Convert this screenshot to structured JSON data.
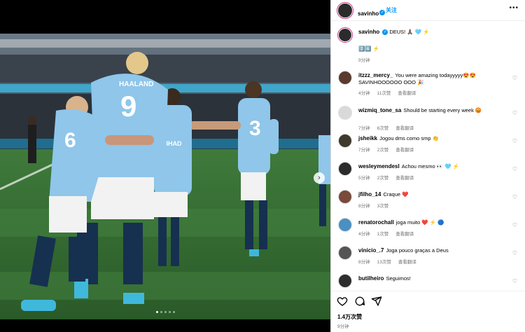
{
  "post": {
    "author": "savinho",
    "follow_label": "关注",
    "more_menu": "•••"
  },
  "caption": {
    "username": "savinho",
    "text": "DEUS! 🙏🏾 🩵 ⚡",
    "extra_line": "2️⃣6️⃣ ⚡",
    "time": "9分钟"
  },
  "comments": [
    {
      "username": "itzzz_mercy_",
      "text": "You were amazing todayyyyy😍😍 SAVINHOOOOOO OOO 🎉",
      "time": "4分钟",
      "likes": "11次赞",
      "translate": "查看翻译",
      "avatar_color": "#5a3b2e"
    },
    {
      "username": "wizmiq_tone_sa",
      "text": "Should be starting every week 😡",
      "time": "7分钟",
      "likes": "6次赞",
      "translate": "查看翻译",
      "avatar_color": "#d9d9d9"
    },
    {
      "username": "jsheikk",
      "text": "Jogou dms como smp 👏",
      "time": "7分钟",
      "likes": "2次赞",
      "translate": "查看翻译",
      "avatar_color": "#3d3a2c"
    },
    {
      "username": "wesleymendesl",
      "text": "Achou mesmo 👀 🩵 ⚡",
      "time": "5分钟",
      "likes": "2次赞",
      "translate": "查看翻译",
      "avatar_color": "#2c2c2c"
    },
    {
      "username": "jfilho_14",
      "text": "Craque ❤️",
      "time": "8分钟",
      "likes": "3次赞",
      "translate": "",
      "avatar_color": "#7a4a3a"
    },
    {
      "username": "renatorochall",
      "text": "joga muito ❤️ ⚡ 🔵",
      "time": "4分钟",
      "likes": "1次赞",
      "translate": "查看翻译",
      "avatar_color": "#4a90c2"
    },
    {
      "username": "vinicio_.7",
      "text": "Joga pouco graças a Deus",
      "time": "8分钟",
      "likes": "13次赞",
      "translate": "查看翻译",
      "avatar_color": "#555555"
    },
    {
      "username": "butilheiro",
      "text": "Seguimos!",
      "time": "",
      "likes": "",
      "translate": "",
      "avatar_color": "#2e2e2e"
    }
  ],
  "footer": {
    "likes": "1.4万次赞",
    "time": "9分钟"
  },
  "icons": {
    "like": "heart-icon",
    "comment": "comment-icon",
    "share": "share-icon",
    "next": "chevron-right-icon"
  },
  "colors": {
    "verified": "#0095f6",
    "follow": "#0095f6",
    "muted": "#737373",
    "avatar_ring": "#c13584"
  }
}
